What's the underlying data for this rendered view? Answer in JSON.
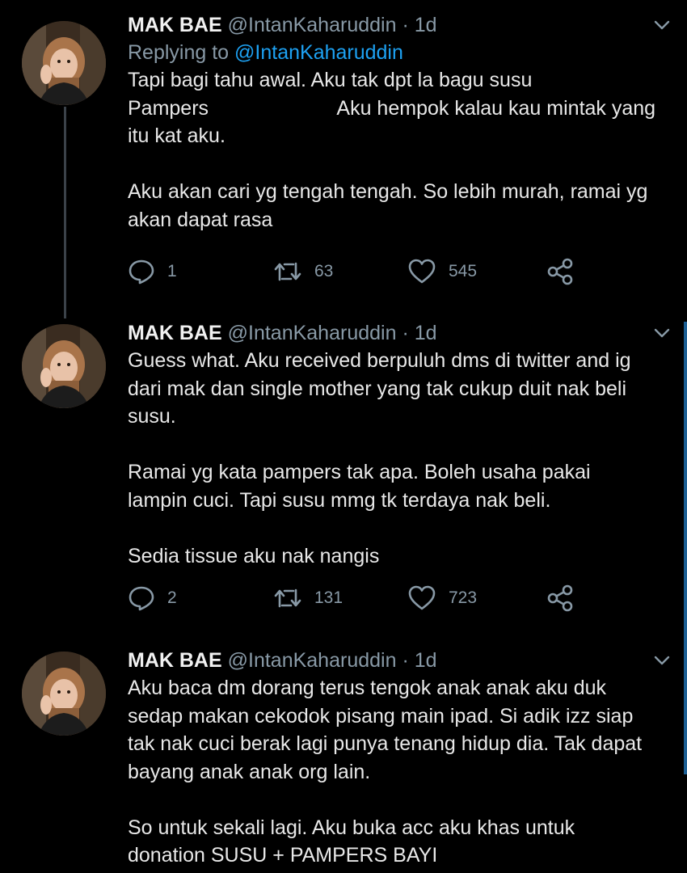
{
  "tweets": [
    {
      "name": "MAK BAE",
      "handle": "@IntanKaharuddin",
      "separator": "·",
      "time": "1d",
      "replying_prefix": "Replying to",
      "replying_to": "@IntanKaharuddin",
      "text": "Tapi bagi tahu awal. Aku tak dpt la bagu susu\nPampers                       Aku hempok kalau kau mintak yang\nitu kat aku.\n\nAku akan cari yg tengah tengah. So lebih murah, ramai yg\nakan dapat rasa",
      "replies": "1",
      "retweets": "63",
      "likes": "545"
    },
    {
      "name": "MAK BAE",
      "handle": "@IntanKaharuddin",
      "separator": "·",
      "time": "1d",
      "text": "Guess what. Aku received berpuluh dms di twitter and ig\ndari mak dan single mother yang tak cukup duit nak beli\nsusu.\n\nRamai yg kata pampers tak apa. Boleh usaha pakai\nlampin cuci. Tapi susu mmg tk terdaya nak beli.\n\nSedia tissue aku nak nangis",
      "replies": "2",
      "retweets": "131",
      "likes": "723"
    },
    {
      "name": "MAK BAE",
      "handle": "@IntanKaharuddin",
      "separator": "·",
      "time": "1d",
      "text": "Aku baca dm dorang terus tengok anak anak aku duk\nsedap makan cekodok pisang main ipad. Si adik izz siap\ntak nak cuci berak lagi punya tenang hidup dia. Tak dapat\nbayang anak anak org lain.\n\nSo untuk sekali lagi. Aku buka acc aku khas untuk\ndonation SUSU + PAMPERS BAYI"
    }
  ],
  "icons": {
    "reply": "reply-icon",
    "retweet": "retweet-icon",
    "like": "heart-icon",
    "share": "share-icon",
    "more": "chevron-down-icon"
  },
  "colors": {
    "background": "#000000",
    "text": "#e8e8e8",
    "secondary": "#8899a6",
    "link": "#1da1f2"
  }
}
